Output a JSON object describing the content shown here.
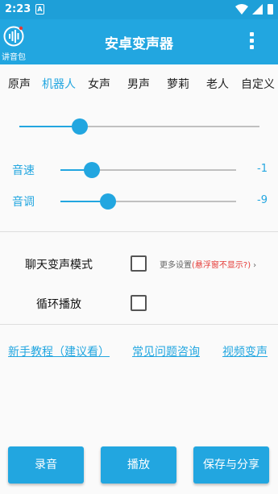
{
  "status_bar": {
    "time": "2:23",
    "notification_glyph": "A"
  },
  "app_bar": {
    "logo_label": "讲音包",
    "title": "安卓变声器"
  },
  "tabs": [
    {
      "label": "原声",
      "active": false
    },
    {
      "label": "机器人",
      "active": true
    },
    {
      "label": "女声",
      "active": false
    },
    {
      "label": "男声",
      "active": false
    },
    {
      "label": "萝莉",
      "active": false
    },
    {
      "label": "老人",
      "active": false
    },
    {
      "label": "自定义",
      "active": false
    }
  ],
  "main_slider": {
    "level": 0.25
  },
  "params": {
    "speed": {
      "label": "音速",
      "value": "-1",
      "level": 0.18
    },
    "pitch": {
      "label": "音调",
      "value": "-9",
      "level": 0.27
    }
  },
  "options": {
    "chat_mode": {
      "label": "聊天变声模式",
      "checked": false
    },
    "loop_play": {
      "label": "循环播放",
      "checked": false
    },
    "more_settings": {
      "prefix": "更多设置",
      "warning": "(悬浮窗不显示?)",
      "chevron": "›"
    }
  },
  "links": {
    "tutorial": "新手教程（建议看）",
    "faq": "常见问题咨询",
    "video": "视频变声"
  },
  "buttons": {
    "record": "录音",
    "play": "播放",
    "save_share": "保存与分享"
  },
  "colors": {
    "accent": "#22a6e0",
    "status_bar": "#1e9fd8",
    "warning": "#e53935"
  }
}
